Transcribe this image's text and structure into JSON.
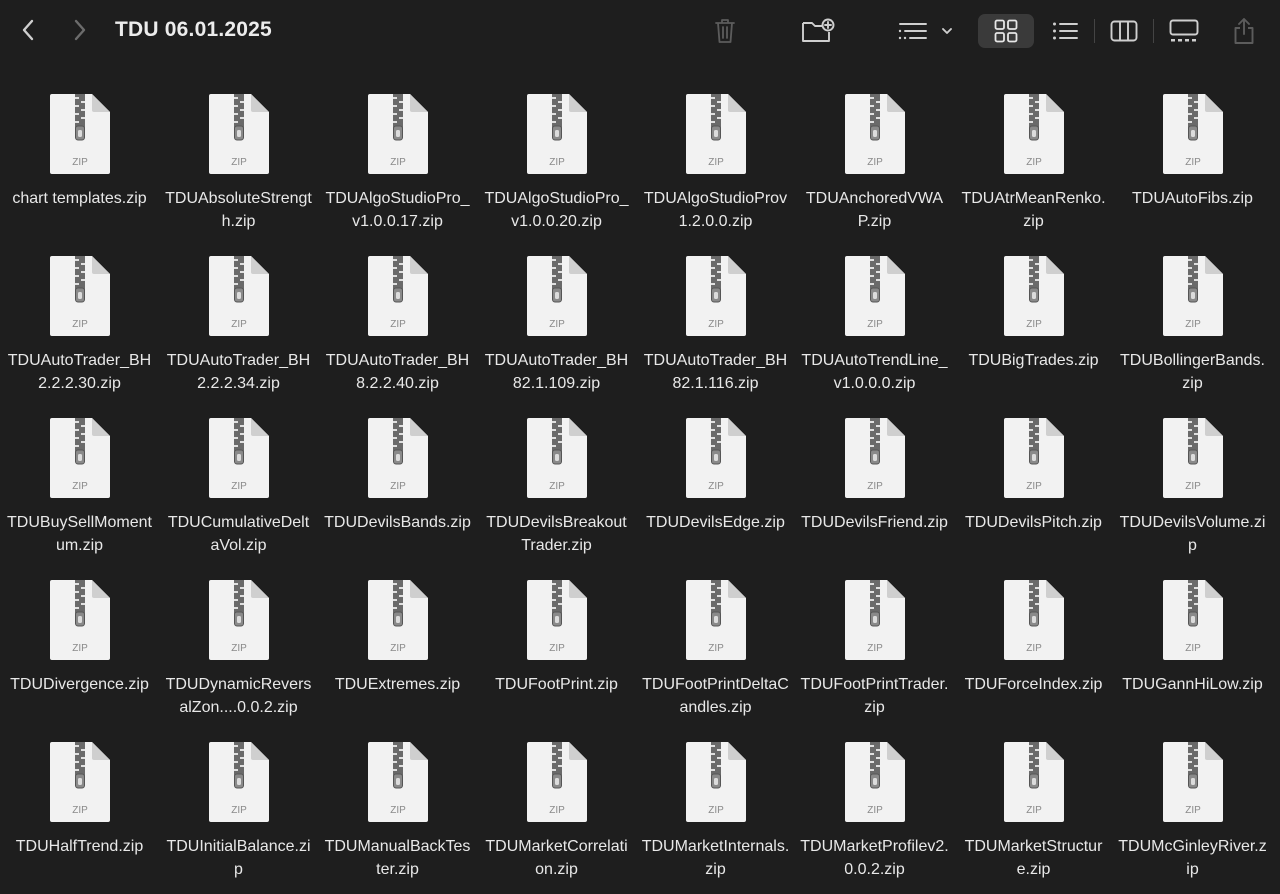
{
  "window": {
    "title": "TDU 06.01.2025"
  },
  "toolbar": {
    "icons": {
      "back": "chevron-left-icon",
      "forward": "chevron-right-icon",
      "trash": "trash-icon",
      "new_folder": "new-folder-icon",
      "group": "group-by-icon",
      "icon_view": "icon-view-icon",
      "list_view": "list-view-icon",
      "column_view": "column-view-icon",
      "gallery_view": "gallery-view-icon",
      "share": "share-icon"
    },
    "active_view": "icon-view"
  },
  "file_badge": "ZIP",
  "files": [
    {
      "name": "chart templates.zip"
    },
    {
      "name": "TDUAbsoluteStrength.zip"
    },
    {
      "name": "TDUAlgoStudioPro_v1.0.0.17.zip"
    },
    {
      "name": "TDUAlgoStudioPro_v1.0.0.20.zip"
    },
    {
      "name": "TDUAlgoStudioProv1.2.0.0.zip"
    },
    {
      "name": "TDUAnchoredVWAP.zip"
    },
    {
      "name": "TDUAtrMeanRenko.zip"
    },
    {
      "name": "TDUAutoFibs.zip"
    },
    {
      "name": "TDUAutoTrader_BH2.2.2.30.zip"
    },
    {
      "name": "TDUAutoTrader_BH2.2.2.34.zip"
    },
    {
      "name": "TDUAutoTrader_BH8.2.2.40.zip"
    },
    {
      "name": "TDUAutoTrader_BH82.1.109.zip"
    },
    {
      "name": "TDUAutoTrader_BH82.1.116.zip"
    },
    {
      "name": "TDUAutoTrendLine_v1.0.0.0.zip"
    },
    {
      "name": "TDUBigTrades.zip"
    },
    {
      "name": "TDUBollingerBands.zip"
    },
    {
      "name": "TDUBuySellMomentum.zip"
    },
    {
      "name": "TDUCumulativeDeltaVol.zip"
    },
    {
      "name": "TDUDevilsBands.zip"
    },
    {
      "name": "TDUDevilsBreakoutTrader.zip"
    },
    {
      "name": "TDUDevilsEdge.zip"
    },
    {
      "name": "TDUDevilsFriend.zip"
    },
    {
      "name": "TDUDevilsPitch.zip"
    },
    {
      "name": "TDUDevilsVolume.zip"
    },
    {
      "name": "TDUDivergence.zip"
    },
    {
      "name": "TDUDynamicReversalZon....0.0.2.zip"
    },
    {
      "name": "TDUExtremes.zip"
    },
    {
      "name": "TDUFootPrint.zip"
    },
    {
      "name": "TDUFootPrintDeltaCandles.zip"
    },
    {
      "name": "TDUFootPrintTrader.zip"
    },
    {
      "name": "TDUForceIndex.zip"
    },
    {
      "name": "TDUGannHiLow.zip"
    },
    {
      "name": "TDUHalfTrend.zip"
    },
    {
      "name": "TDUInitialBalance.zip"
    },
    {
      "name": "TDUManualBackTester.zip"
    },
    {
      "name": "TDUMarketCorrelation.zip"
    },
    {
      "name": "TDUMarketInternals.zip"
    },
    {
      "name": "TDUMarketProfilev2.0.0.2.zip"
    },
    {
      "name": "TDUMarketStructure.zip"
    },
    {
      "name": "TDUMcGinleyRiver.zip"
    }
  ]
}
